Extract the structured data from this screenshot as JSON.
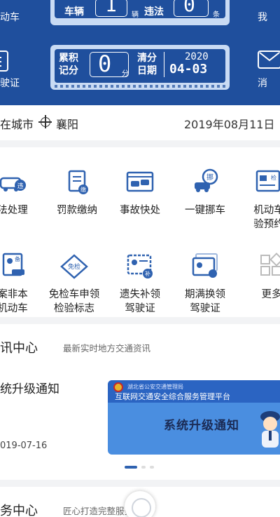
{
  "banner": {
    "left_top_label": "动车",
    "left_bottom_label": "驶证",
    "right_top_label": "我",
    "right_bottom_label": "消",
    "top_card": {
      "vehicle_label": "车辆",
      "vehicle_count": "1",
      "vehicle_unit": "辆",
      "violation_label": "违法",
      "violation_count": "0",
      "violation_unit": "条"
    },
    "bottom_card": {
      "points_label_1": "累积",
      "points_label_2": "记分",
      "points_value": "0",
      "points_unit": "分",
      "clear_label_1": "清分",
      "clear_label_2": "日期",
      "clear_year": "2020",
      "clear_md": "04-03"
    }
  },
  "location": {
    "label": "在城市",
    "city": "襄阳",
    "date": "2019年08月11日"
  },
  "services": [
    {
      "label": "法处理",
      "icon": "car-violation-icon"
    },
    {
      "label": "罚款缴纳",
      "icon": "fine-payment-icon"
    },
    {
      "label": "事故快处",
      "icon": "accident-icon"
    },
    {
      "label": "一键挪车",
      "icon": "move-car-icon"
    },
    {
      "label": "机动车",
      "label2": "验预约",
      "icon": "inspection-booking-icon"
    },
    {
      "label": "案非本",
      "label2": "机动车",
      "icon": "nonlocal-vehicle-icon"
    },
    {
      "label": "免检车申领",
      "label2": "检验标志",
      "icon": "exempt-label-icon"
    },
    {
      "label": "遗失补领",
      "label2": "驾驶证",
      "icon": "lost-license-icon"
    },
    {
      "label": "期满换领",
      "label2": "驾驶证",
      "icon": "renew-license-icon"
    },
    {
      "label": "更多",
      "icon": "more-grid-icon"
    }
  ],
  "news": {
    "title": "讯中心",
    "subtitle": "最新实时地方交通资讯",
    "item_title": "统升级通知",
    "item_date": "019-07-16",
    "image_org_small": "湖北省公安交通管理局",
    "image_org": "互联网交通安全综合服务管理平台",
    "image_headline": "系统升级通知"
  },
  "service_center": {
    "title": "务中心",
    "subtitle": "匠心打造完整服务体系"
  },
  "colors": {
    "brand_blue": "#1f4f9d",
    "icon_blue": "#2f62b0"
  }
}
